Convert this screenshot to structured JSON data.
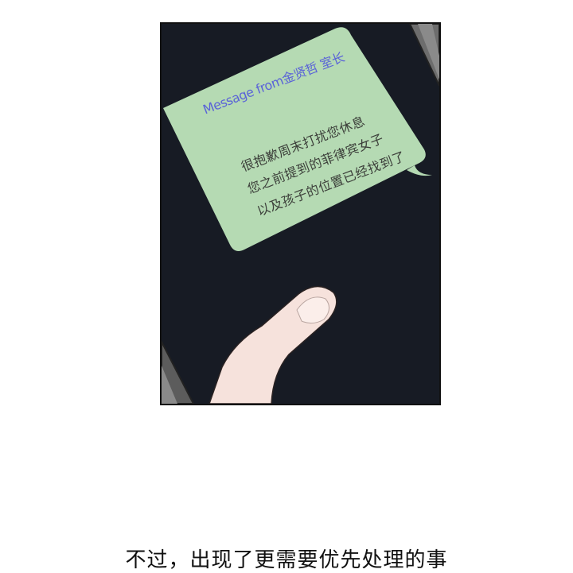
{
  "panel": {
    "message": {
      "sender": "Message from金贤哲 室长",
      "lines": [
        "很抱歉周末打扰您休息",
        "您之前提到的菲律宾女子",
        "以及孩子的位置已经找到了"
      ]
    }
  },
  "caption": {
    "text": "不过，出现了更需要优先处理的事"
  },
  "colors": {
    "panel_background": "#171b24",
    "bubble": "#b5dab3",
    "sender_text": "#5a63d8",
    "message_text": "#3c3f3a",
    "skin": "#f6e2dc"
  }
}
